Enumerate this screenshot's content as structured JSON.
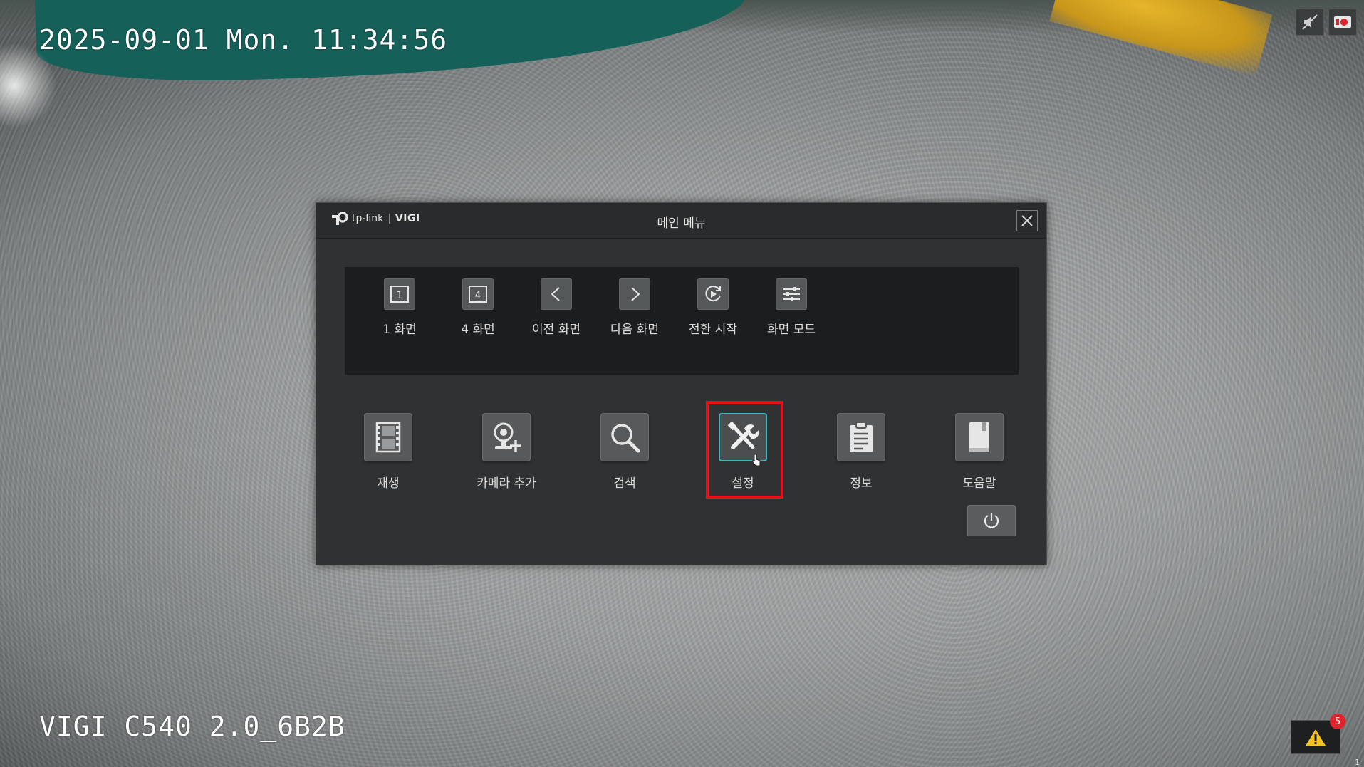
{
  "osd": {
    "datetime": "2025-09-01 Mon. 11:34:56",
    "camera_name": "VIGI C540 2.0_6B2B"
  },
  "top_right": {
    "icons": [
      "mute-audio-icon",
      "record-icon"
    ]
  },
  "dialog": {
    "logo_brand": "tp-link",
    "logo_product": "VIGI",
    "title": "메인 메뉴",
    "quick_items": [
      {
        "label": "1 화면",
        "icon": "single-screen-icon"
      },
      {
        "label": "4 화면",
        "icon": "quad-screen-icon"
      },
      {
        "label": "이전 화면",
        "icon": "chevron-left-icon"
      },
      {
        "label": "다음 화면",
        "icon": "chevron-right-icon"
      },
      {
        "label": "전환 시작",
        "icon": "sequence-refresh-icon"
      },
      {
        "label": "화면 모드",
        "icon": "sliders-icon"
      }
    ],
    "main_items": [
      {
        "label": "재생",
        "icon": "film-icon"
      },
      {
        "label": "카메라 추가",
        "icon": "add-camera-icon"
      },
      {
        "label": "검색",
        "icon": "search-icon"
      },
      {
        "label": "설정",
        "icon": "wrench-screwdriver-icon",
        "selected": true
      },
      {
        "label": "정보",
        "icon": "clipboard-icon"
      },
      {
        "label": "도움말",
        "icon": "book-icon"
      }
    ]
  },
  "alarm": {
    "count": "5",
    "corner_number": "1"
  },
  "colors": {
    "highlight": "#e0141c",
    "selected_border": "#3fb6c1",
    "alarm_badge": "#e0232b"
  }
}
